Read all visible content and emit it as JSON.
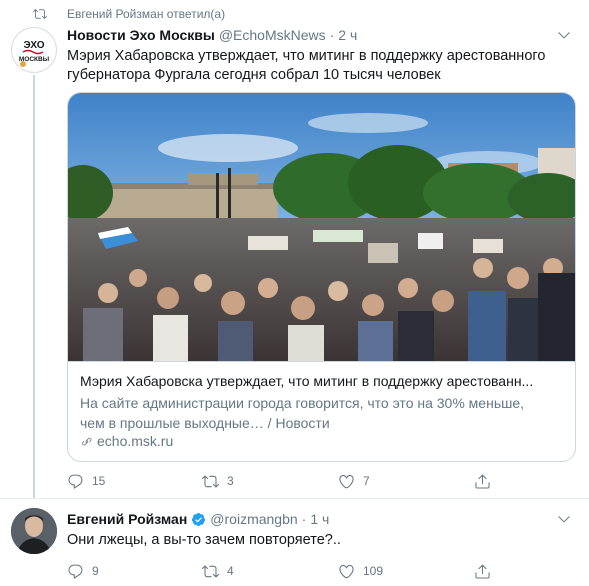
{
  "retweet": {
    "text": "Евгений Ройзман ответил(а)",
    "icon": "retweet-icon"
  },
  "tweet1": {
    "avatar_text": [
      "ЭХО",
      "МОСКВЫ"
    ],
    "name": "Новости Эхо Москвы",
    "handle": "@EchoMskNews",
    "dot": "·",
    "time": "2 ч",
    "text_lines": [
      "Мэрия Хабаровска утверждает, что митинг в поддержку арестованного",
      "губернатора Фургала сегодня собрал 10 тысяч человек"
    ],
    "card": {
      "title": "Мэрия Хабаровска утверждает, что митинг в поддержку арестованн...",
      "description_lines": [
        "На сайте администрации города говорится, что это на 30% меньше,",
        "чем в прошлые выходные… / Новости"
      ],
      "domain": "echo.msk.ru",
      "photo_icon": "rally-crowd-photo"
    },
    "actions": {
      "replies": "15",
      "retweets": "3",
      "likes": "7"
    }
  },
  "tweet2": {
    "name": "Евгений Ройзман",
    "handle": "@roizmangbn",
    "dot": "·",
    "time": "1 ч",
    "text": "Они лжецы, а вы-то зачем повторяете?..",
    "actions": {
      "replies": "9",
      "retweets": "4",
      "likes": "109"
    }
  },
  "colors": {
    "text": "#14171a",
    "muted": "#657786",
    "border": "#ccd6dd",
    "verified": "#1da1f2",
    "echo_red": "#c8102e"
  }
}
